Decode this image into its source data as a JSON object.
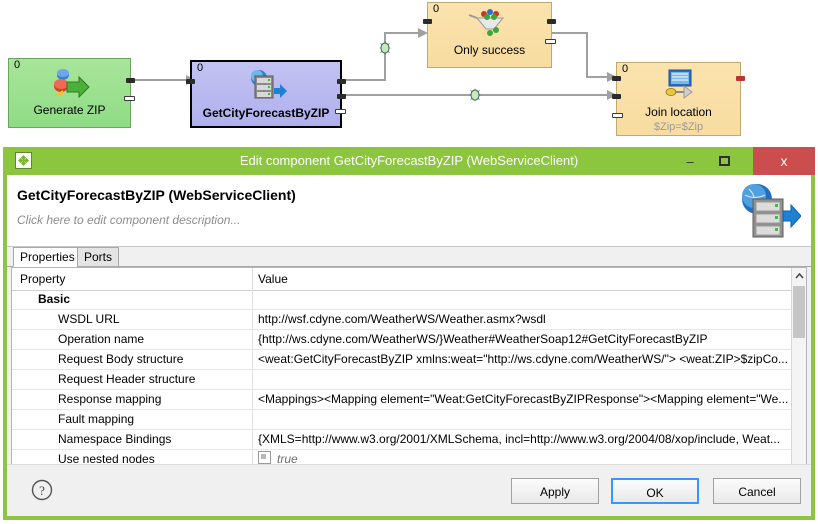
{
  "graph": {
    "nodes": [
      {
        "id": "generate-zip",
        "count": "0",
        "label": "Generate ZIP",
        "sub": "",
        "icon": "generate-data-icon",
        "color": "#9ce08e"
      },
      {
        "id": "getcityforecastbyzip",
        "count": "0",
        "label": "GetCityForecastByZIP",
        "sub": "",
        "icon": "web-service-client-icon",
        "color": "#b9b9f0"
      },
      {
        "id": "only-success",
        "count": "0",
        "label": "Only success",
        "sub": "",
        "icon": "filter-icon",
        "color": "#f9dfa5"
      },
      {
        "id": "join-location",
        "count": "0",
        "label": "Join location",
        "sub": "$Zip=$Zip",
        "icon": "join-icon",
        "color": "#f9dfa5"
      }
    ],
    "edge_markers": [
      {
        "id": "edge-metadata-1",
        "icon": "metadata-sparkle-icon"
      },
      {
        "id": "edge-metadata-2",
        "icon": "metadata-sparkle-icon"
      }
    ]
  },
  "dialog": {
    "window_icon": "clover-icon",
    "title": "Edit component GetCityForecastByZIP (WebServiceClient)",
    "minimize_label": "–",
    "maximize_label": "▭",
    "close_label": "x",
    "header": {
      "title": "GetCityForecastByZIP (WebServiceClient)",
      "description_placeholder": "Click here to edit component description...",
      "icon": "web-service-server-icon"
    },
    "tabs": [
      {
        "label": "Properties",
        "active": true
      },
      {
        "label": "Ports",
        "active": false
      }
    ],
    "table": {
      "columns": [
        "Property",
        "Value"
      ],
      "rows": [
        {
          "level": "group",
          "property": "Basic",
          "value": "",
          "type": "text"
        },
        {
          "level": "item",
          "property": "WSDL URL",
          "value": "http://wsf.cdyne.com/WeatherWS/Weather.asmx?wsdl",
          "type": "text"
        },
        {
          "level": "item",
          "property": "Operation name",
          "value": "{http://ws.cdyne.com/WeatherWS/}Weather#WeatherSoap12#GetCityForecastByZIP",
          "type": "text"
        },
        {
          "level": "item",
          "property": "Request Body structure",
          "value": "<weat:GetCityForecastByZIP xmlns:weat=\"http://ws.cdyne.com/WeatherWS/\">  <weat:ZIP>$zipCo...",
          "type": "text"
        },
        {
          "level": "item",
          "property": "Request Header structure",
          "value": "",
          "type": "text"
        },
        {
          "level": "item",
          "property": "Response mapping",
          "value": "<Mappings><Mapping element=\"Weat:GetCityForecastByZIPResponse\"><Mapping element=\"We...",
          "type": "text"
        },
        {
          "level": "item",
          "property": "Fault mapping",
          "value": "",
          "type": "text"
        },
        {
          "level": "item",
          "property": "Namespace Bindings",
          "value": "{XMLS=http://www.w3.org/2001/XMLSchema, incl=http://www.w3.org/2004/08/xop/include, Weat...",
          "type": "text"
        },
        {
          "level": "item",
          "property": "Use nested nodes",
          "value": "true",
          "type": "checkbox"
        }
      ],
      "scrollbar": {
        "up": "⌃",
        "down": "⌄"
      }
    },
    "footer": {
      "help_icon": "help-question-icon",
      "apply_label": "Apply",
      "ok_label": "OK",
      "cancel_label": "Cancel"
    },
    "colors": {
      "titlebar": "#8cc63e",
      "close": "#cb4d4d",
      "focus_ring": "#3399ff"
    }
  }
}
